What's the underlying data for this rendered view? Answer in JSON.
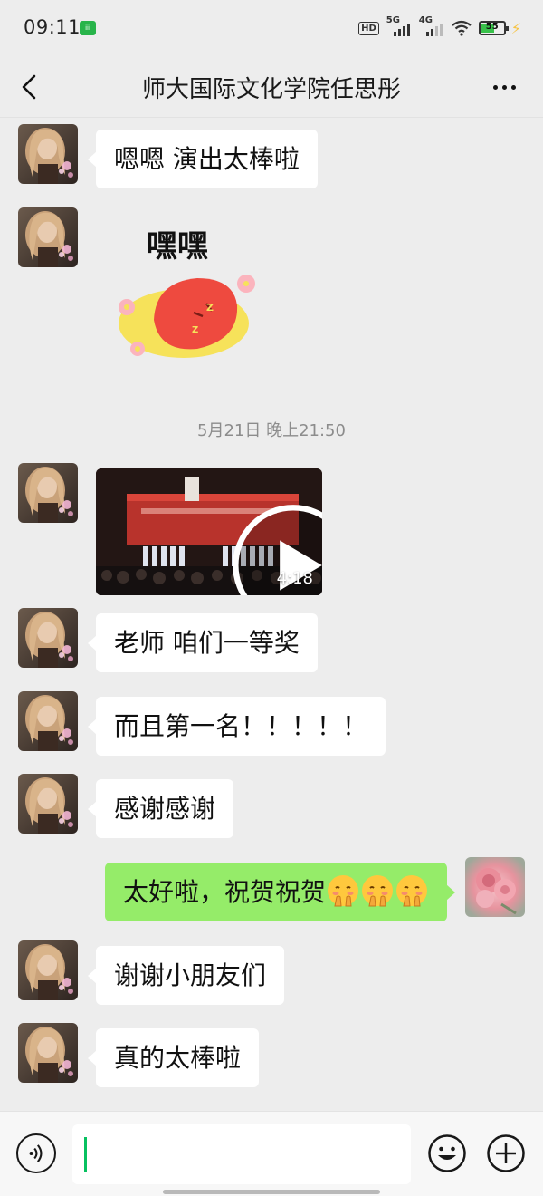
{
  "status_bar": {
    "time": "09:11",
    "hd": "HD",
    "signal_1": "5G",
    "signal_2": "4G",
    "battery": "55",
    "battery_level": 0.55
  },
  "header": {
    "title": "师大国际文化学院任思彤"
  },
  "messages": [
    {
      "text": "嗯嗯 演出太棒啦"
    },
    {
      "sticker_text": "嘿嘿"
    },
    {
      "divider": "5月21日 晚上21:50"
    },
    {
      "video_duration": "4:18"
    },
    {
      "text": "老师 咱们一等奖"
    },
    {
      "text": "而且第一名！！！！！"
    },
    {
      "text": "感谢感谢"
    },
    {
      "text": "太好啦，祝贺祝贺"
    },
    {
      "text": "谢谢小朋友们"
    },
    {
      "text": "真的太棒啦"
    }
  ],
  "colors": {
    "background": "#ededed",
    "bubble_left": "#ffffff",
    "bubble_right": "#95ec69",
    "cursor": "#07c160"
  }
}
